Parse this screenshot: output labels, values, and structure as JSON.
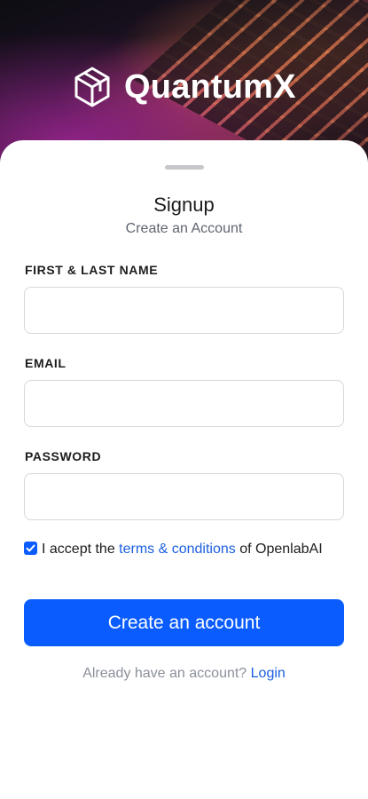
{
  "brand": {
    "name": "QuantumX",
    "icon": "cube-logo-icon"
  },
  "sheet": {
    "title": "Signup",
    "subtitle": "Create an Account"
  },
  "form": {
    "name_label": "FIRST & LAST NAME",
    "name_value": "",
    "email_label": "EMAIL",
    "email_value": "",
    "password_label": "PASSWORD",
    "password_value": ""
  },
  "terms": {
    "checked": true,
    "prefix": "I accept the",
    "link": "terms & conditions",
    "suffix": "of OpenlabAI"
  },
  "actions": {
    "create_label": "Create an account",
    "login_prompt": "Already have an account?",
    "login_link": "Login"
  },
  "colors": {
    "primary": "#0a5cff",
    "link": "#1b5fe0",
    "muted": "#8a8f99"
  }
}
